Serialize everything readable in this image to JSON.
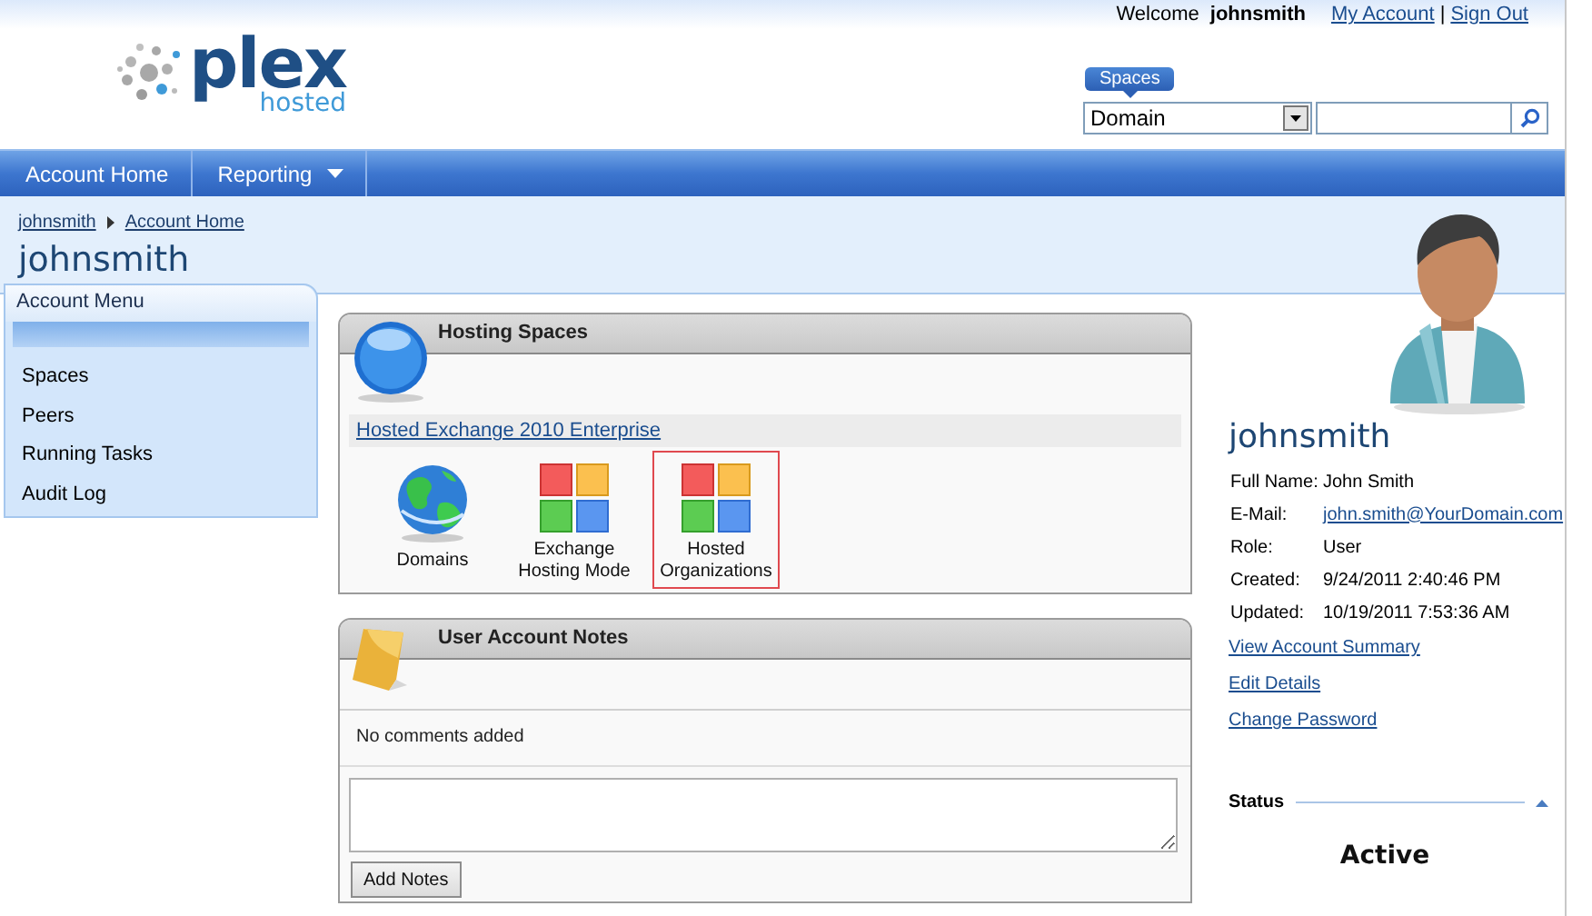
{
  "header": {
    "logo": {
      "name": "plex",
      "tagline": "hosted"
    },
    "welcome": "Welcome",
    "user": "johnsmith",
    "links": [
      "My Account",
      "Sign Out"
    ],
    "separator": "|",
    "spaces": {
      "label": "Spaces",
      "select_value": "Domain"
    }
  },
  "nav": [
    {
      "label": "Account Home",
      "has_menu": false
    },
    {
      "label": "Reporting",
      "has_menu": true
    }
  ],
  "breadcrumb": [
    "johnsmith",
    "Account Home"
  ],
  "page_title": "johnsmith",
  "account_menu": {
    "title": "Account Menu",
    "items": [
      "Spaces",
      "Peers",
      "Running Tasks",
      "Audit Log"
    ]
  },
  "hosting_spaces": {
    "title": "Hosting Spaces",
    "plan": "Hosted Exchange 2010 Enterprise",
    "items": [
      {
        "label": "Domains",
        "kind": "globe",
        "selected": false
      },
      {
        "label": "Exchange Hosting Mode",
        "kind": "tiles",
        "selected": false
      },
      {
        "label": "Hosted Organizations",
        "kind": "tiles",
        "selected": true
      }
    ]
  },
  "notes": {
    "title": "User Account Notes",
    "empty_text": "No comments added",
    "button": "Add Notes"
  },
  "profile": {
    "name": "johnsmith",
    "fields": [
      {
        "label": "Full Name:",
        "value": "John Smith",
        "kind": "text"
      },
      {
        "label": "E-Mail:",
        "value": "john.smith@YourDomain.com",
        "kind": "link"
      },
      {
        "label": "Role:",
        "value": "User",
        "kind": "text"
      },
      {
        "label": "Created:",
        "value": "9/24/2011 2:40:46 PM",
        "kind": "text"
      },
      {
        "label": "Updated:",
        "value": "10/19/2011 7:53:36 AM",
        "kind": "text"
      }
    ],
    "links": [
      "View Account Summary",
      "Edit Details",
      "Change Password"
    ],
    "status": {
      "title": "Status",
      "expanded": true,
      "value": "Active"
    }
  }
}
